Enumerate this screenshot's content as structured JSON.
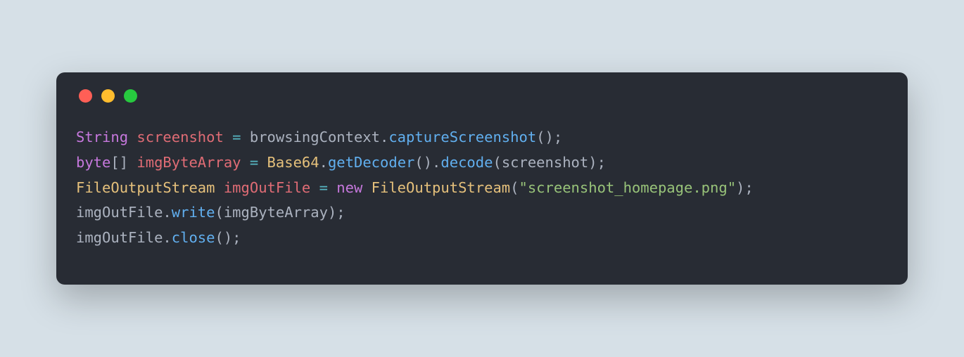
{
  "colors": {
    "bg": "#d6e0e7",
    "window": "#282c34",
    "red": "#ff5f56",
    "yellow": "#ffbd2e",
    "green": "#27c93f",
    "type": "#c678dd",
    "var": "#e06c75",
    "op": "#56b6c2",
    "ident": "#abb2bf",
    "method": "#61afef",
    "obj": "#e5c07b",
    "kw": "#c678dd",
    "class": "#e5c07b",
    "str": "#98c379"
  },
  "code": {
    "lines": [
      [
        {
          "t": "type",
          "v": "String"
        },
        {
          "t": "sp",
          "v": " "
        },
        {
          "t": "var",
          "v": "screenshot"
        },
        {
          "t": "sp",
          "v": " "
        },
        {
          "t": "op",
          "v": "="
        },
        {
          "t": "sp",
          "v": " "
        },
        {
          "t": "ident",
          "v": "browsingContext"
        },
        {
          "t": "punct",
          "v": "."
        },
        {
          "t": "method",
          "v": "captureScreenshot"
        },
        {
          "t": "punct",
          "v": "();"
        }
      ],
      [
        {
          "t": "type",
          "v": "byte"
        },
        {
          "t": "punct",
          "v": "[]"
        },
        {
          "t": "sp",
          "v": " "
        },
        {
          "t": "var",
          "v": "imgByteArray"
        },
        {
          "t": "sp",
          "v": " "
        },
        {
          "t": "op",
          "v": "="
        },
        {
          "t": "sp",
          "v": " "
        },
        {
          "t": "obj",
          "v": "Base64"
        },
        {
          "t": "punct",
          "v": "."
        },
        {
          "t": "method",
          "v": "getDecoder"
        },
        {
          "t": "punct",
          "v": "()."
        },
        {
          "t": "method",
          "v": "decode"
        },
        {
          "t": "punct",
          "v": "("
        },
        {
          "t": "ident",
          "v": "screenshot"
        },
        {
          "t": "punct",
          "v": ");"
        }
      ],
      [
        {
          "t": "class",
          "v": "FileOutputStream"
        },
        {
          "t": "sp",
          "v": " "
        },
        {
          "t": "var",
          "v": "imgOutFile"
        },
        {
          "t": "sp",
          "v": " "
        },
        {
          "t": "op",
          "v": "="
        },
        {
          "t": "sp",
          "v": " "
        },
        {
          "t": "kw",
          "v": "new"
        },
        {
          "t": "sp",
          "v": " "
        },
        {
          "t": "class",
          "v": "FileOutputStream"
        },
        {
          "t": "punct",
          "v": "("
        },
        {
          "t": "str",
          "v": "\"screenshot_homepage.png\""
        },
        {
          "t": "punct",
          "v": ");"
        }
      ],
      [
        {
          "t": "ident",
          "v": "imgOutFile"
        },
        {
          "t": "punct",
          "v": "."
        },
        {
          "t": "method",
          "v": "write"
        },
        {
          "t": "punct",
          "v": "("
        },
        {
          "t": "ident",
          "v": "imgByteArray"
        },
        {
          "t": "punct",
          "v": ");"
        }
      ],
      [
        {
          "t": "ident",
          "v": "imgOutFile"
        },
        {
          "t": "punct",
          "v": "."
        },
        {
          "t": "method",
          "v": "close"
        },
        {
          "t": "punct",
          "v": "();"
        }
      ]
    ]
  }
}
